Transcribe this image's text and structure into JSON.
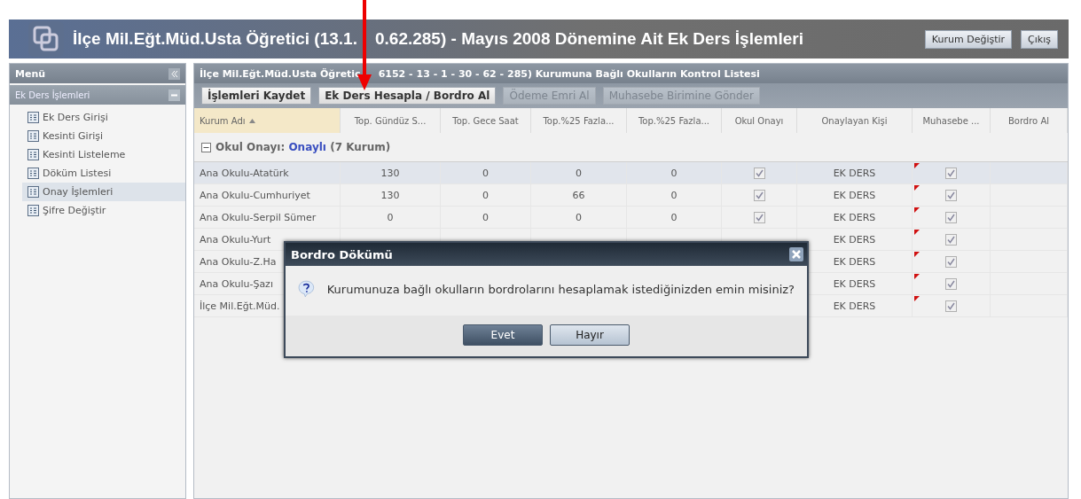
{
  "header": {
    "title_parts": [
      "İlçe Mil.Eğt.Müd.Usta Öğretici (13.1.",
      "0.62.285) - Mayıs 2008 Dönemine Ait Ek Ders İşlemleri"
    ],
    "buttons": [
      {
        "label": "Kurum Değiştir"
      },
      {
        "label": "Çıkış"
      }
    ]
  },
  "sidebar": {
    "title": "Menü",
    "section": "Ek Ders İşlemleri",
    "items": [
      {
        "label": "Ek Ders Girişi",
        "selected": false
      },
      {
        "label": "Kesinti Girişi",
        "selected": false
      },
      {
        "label": "Kesinti Listeleme",
        "selected": false
      },
      {
        "label": "Döküm Listesi",
        "selected": false
      },
      {
        "label": "Onay İşlemleri",
        "selected": true
      },
      {
        "label": "Şifre Değiştir",
        "selected": false
      }
    ]
  },
  "main": {
    "title_parts": [
      "İlçe Mil.Eğt.Müd.Usta Öğretic",
      "6152 - 13 - 1 - 30 - 62 - 285) Kurumuna Bağlı Okulların Kontrol Listesi"
    ],
    "toolbar": [
      {
        "label": "İşlemleri Kaydet",
        "disabled": false
      },
      {
        "label": "Ek Ders Hesapla / Bordro Al",
        "disabled": false
      },
      {
        "label": "Ödeme Emri Al",
        "disabled": true
      },
      {
        "label": "Muhasebe Birimine Gönder",
        "disabled": true
      }
    ],
    "table": {
      "columns": [
        {
          "label": "Kurum Adı",
          "sorted": true
        },
        {
          "label": "Top. Gündüz S...",
          "sorted": false
        },
        {
          "label": "Top. Gece Saat",
          "sorted": false
        },
        {
          "label": "Top.%25 Fazla...",
          "sorted": false
        },
        {
          "label": "Top.%25 Fazla...",
          "sorted": false
        },
        {
          "label": "Okul Onayı",
          "sorted": false
        },
        {
          "label": "Onaylayan Kişi",
          "sorted": false
        },
        {
          "label": "Muhasebe ...",
          "sorted": false
        },
        {
          "label": "Bordro Al",
          "sorted": false
        }
      ],
      "group": {
        "expanded": true,
        "label": "Okul Onayı:",
        "value": "Onaylı",
        "count": "(7 Kurum)"
      },
      "rows": [
        {
          "selected": true,
          "name": "Ana Okulu-Atatürk",
          "values": [
            "130",
            "0",
            "0",
            "0"
          ],
          "school_approved": true,
          "approver": "EK DERS",
          "modified": true,
          "accounting": true
        },
        {
          "selected": false,
          "name": "Ana Okulu-Cumhuriyet",
          "values": [
            "130",
            "0",
            "66",
            "0"
          ],
          "school_approved": true,
          "approver": "EK DERS",
          "modified": true,
          "accounting": true
        },
        {
          "selected": false,
          "name": "Ana Okulu-Serpil Sümer",
          "values": [
            "0",
            "0",
            "0",
            "0"
          ],
          "school_approved": true,
          "approver": "EK DERS",
          "modified": true,
          "accounting": true
        },
        {
          "selected": false,
          "name": "Ana Okulu-Yurt",
          "approver": "EK DERS",
          "modified": true,
          "accounting": true
        },
        {
          "selected": false,
          "name": "Ana Okulu-Z.Ha",
          "approver": "EK DERS",
          "modified": true,
          "accounting": true
        },
        {
          "selected": false,
          "name": "Ana Okulu-Şazı",
          "approver": "EK DERS",
          "modified": true,
          "accounting": true
        },
        {
          "selected": false,
          "name": "İlçe Mil.Eğt.Müd.",
          "approver": "EK DERS",
          "modified": true,
          "accounting": true
        }
      ]
    }
  },
  "dialog": {
    "title": "Bordro Dökümü",
    "message": "Kurumunuza bağlı okulların bordrolarını hesaplamak istediğinizden emin misiniz?",
    "buttons": [
      {
        "label": "Evet",
        "selected": true
      },
      {
        "label": "Hayır",
        "selected": false
      }
    ]
  }
}
